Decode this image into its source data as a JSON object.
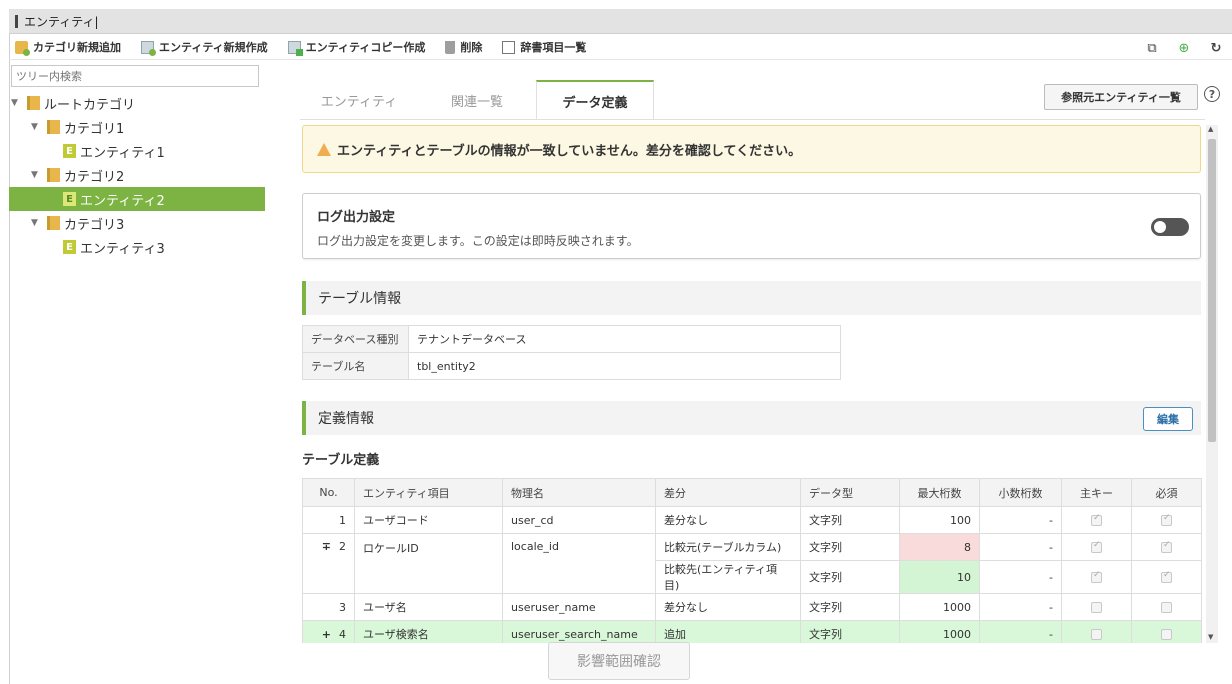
{
  "window": {
    "title": "エンティティ|"
  },
  "toolbar": {
    "add_category": "カテゴリ新規追加",
    "new_entity": "エンティティ新規作成",
    "copy_entity": "エンティティコピー作成",
    "delete": "削除",
    "dictionary": "辞書項目一覧"
  },
  "sidebar": {
    "search_placeholder": "ツリー内検索",
    "tree": [
      {
        "label": "ルートカテゴリ",
        "type": "folder",
        "depth": 0
      },
      {
        "label": "カテゴリ1",
        "type": "folder",
        "depth": 1
      },
      {
        "label": "エンティティ1",
        "type": "entity",
        "depth": 2
      },
      {
        "label": "カテゴリ2",
        "type": "folder",
        "depth": 1
      },
      {
        "label": "エンティティ2",
        "type": "entity",
        "depth": 2,
        "selected": true
      },
      {
        "label": "カテゴリ3",
        "type": "folder",
        "depth": 1
      },
      {
        "label": "エンティティ3",
        "type": "entity",
        "depth": 2
      }
    ]
  },
  "tabs": [
    {
      "label": "エンティティ"
    },
    {
      "label": "関連一覧"
    },
    {
      "label": "データ定義",
      "active": true
    }
  ],
  "ref_button": "参照元エンティティ一覧",
  "help": "?",
  "warning": "エンティティとテーブルの情報が一致していません。差分を確認してください。",
  "log": {
    "title": "ログ出力設定",
    "desc": "ログ出力設定を変更します。この設定は即時反映されます。",
    "enabled": false
  },
  "table_info": {
    "heading": "テーブル情報",
    "db_label": "データベース種別",
    "db_value": "テナントデータベース",
    "name_label": "テーブル名",
    "name_value": "tbl_entity2"
  },
  "definition": {
    "heading": "定義情報",
    "edit": "編集",
    "table_title": "テーブル定義",
    "headers": [
      "No.",
      "エンティティ項目",
      "物理名",
      "差分",
      "データ型",
      "最大桁数",
      "小数桁数",
      "主キー",
      "必須"
    ],
    "rows": [
      {
        "mark": "",
        "no": "1",
        "item": "ユーザコード",
        "phys": "user_cd",
        "diff": "差分なし",
        "type": "文字列",
        "max": "100",
        "dec": "-"
      },
      {
        "mark": "∓",
        "no": "2",
        "item": "ロケールID",
        "phys": "locale_id",
        "diff": "比較元(テーブルカラム)",
        "type": "文字列",
        "max": "8",
        "dec": "-"
      },
      {
        "diff": "比較先(エンティティ項目)",
        "type": "文字列",
        "max": "10",
        "dec": "-"
      },
      {
        "mark": "",
        "no": "3",
        "item": "ユーザ名",
        "phys": "useruser_name",
        "diff": "差分なし",
        "type": "文字列",
        "max": "1000",
        "dec": "-"
      },
      {
        "mark": "+",
        "no": "4",
        "item": "ユーザ検索名",
        "phys": "useruser_search_name",
        "diff": "追加",
        "type": "文字列",
        "max": "1000",
        "dec": "-"
      }
    ]
  },
  "footer_button": "影響範囲確認"
}
